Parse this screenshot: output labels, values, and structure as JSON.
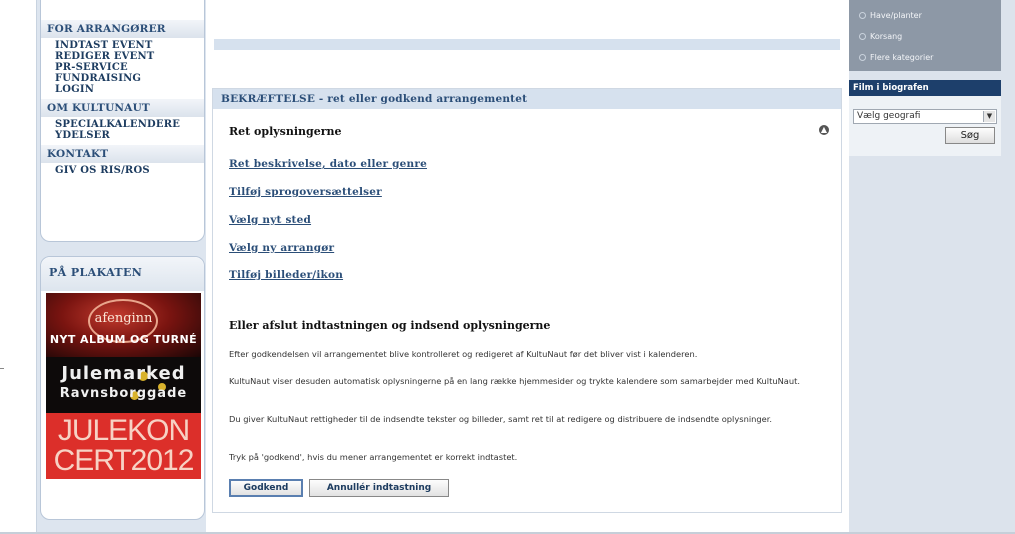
{
  "left_nav": {
    "arrangoer": {
      "heading": "FOR ARRANGØRER",
      "items": [
        "INDTAST EVENT",
        "REDIGER EVENT",
        "PR-SERVICE",
        "FUNDRAISING",
        "LOGIN"
      ]
    },
    "om": {
      "heading": "OM KULTUNAUT",
      "items": [
        "SPECIALKALENDERE",
        "YDELSER"
      ]
    },
    "kontakt": {
      "heading": "KONTAKT",
      "items": [
        "GIV OS RIS/ROS"
      ]
    },
    "plakaten": {
      "heading": "PÅ PLAKATEN",
      "posters": [
        {
          "line1": "afenginn",
          "line2": "NYT ALBUM OG TURNÉ"
        },
        {
          "line1": "Julemarked",
          "line2": "Ravnsborggade"
        },
        {
          "line1": "JULEKON",
          "line2": "CERT2012"
        }
      ]
    }
  },
  "main": {
    "panel_title": "BEKRÆFTELSE - ret eller godkend arrangementet",
    "correct_title": "Ret oplysningerne",
    "links": [
      "Ret beskrivelse, dato eller genre",
      "Tilføj sprogoversættelser",
      "Vælg nyt sted",
      "Vælg ny arrangør",
      "Tilføj billeder/ikon"
    ],
    "finish_title": "Eller afslut indtastningen og indsend oplysningerne",
    "paragraphs": [
      "Efter godkendelsen vil arrangementet blive kontrolleret og redigeret af KultuNaut før det bliver vist i kalenderen.",
      "KultuNaut viser desuden automatisk oplysningerne på en lang række hjemmesider og trykte kalendere som samarbejder med KultuNaut.",
      "Du giver KultuNaut rettigheder til de indsendte tekster og billeder, samt ret til at redigere og distribuere de indsendte oplysninger.",
      "Tryk på 'godkend', hvis du mener arrangementet er korrekt indtastet."
    ],
    "approve_label": "Godkend",
    "cancel_label": "Annullér indtastning"
  },
  "right": {
    "categories": [
      "Have/planter",
      "Korsang",
      "Flere kategorier"
    ],
    "film_heading": "Film i biografen",
    "geo_select_value": "Vælg geografi",
    "search_label": "Søg"
  }
}
